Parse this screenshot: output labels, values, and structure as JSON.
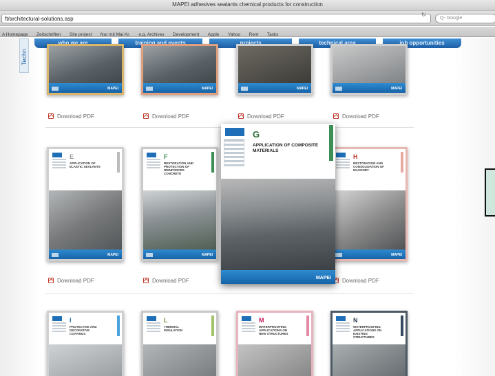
{
  "window": {
    "title": "MAPEI adhesives sealants chemical products for construction"
  },
  "browser": {
    "url": "ft/architectural-solutions.asp",
    "search_placeholder": "Q- Google",
    "bookmarks": [
      "A Homepage",
      "Zeitschriften",
      "Site project",
      "Nur mit Mai Kr.",
      "e.g. Archives",
      "Development",
      "Apple",
      "Yahoo",
      "Rent",
      "Tasks"
    ]
  },
  "sidebar": {
    "tab_label": "Techn"
  },
  "nav": {
    "items": [
      "who we are",
      "training and events",
      "projects",
      "technical area",
      "job opportunities"
    ]
  },
  "downloads": {
    "label": "Download PDF"
  },
  "covers": {
    "row2": [
      {
        "letter": "E",
        "title": "APPLICATION OF ELASTIC SEALANTS"
      },
      {
        "letter": "F",
        "title": "RESTORATION AND PROTECTION OF REINFORCED CONCRETE"
      },
      {
        "letter": "H",
        "title": "RESTORATION AND CONSOLIDATION OF MASONRY"
      }
    ],
    "row3": [
      {
        "letter": "I",
        "title": "PROTECTIVE AND DECORATIVE COATINGS"
      },
      {
        "letter": "L",
        "title": "THERMAL INSULATION"
      },
      {
        "letter": "M",
        "title": "WATERPROOFING APPLICATIONS ON NEW STRUCTURES"
      },
      {
        "letter": "N",
        "title": "WATERPROOFING APPLICATIONS ON EXISTING STRUCTURES"
      }
    ],
    "featured": {
      "letter": "G",
      "title": "APPLICATION OF COMPOSITE MATERIALS",
      "logo": "MAPEI"
    },
    "logo": "MAPEI"
  },
  "colors": {
    "nav_blue": "#1d5ea6",
    "band_blue": "#1563a8",
    "featured_accent": "#3c8f55",
    "pdf_red": "#c0392b"
  }
}
